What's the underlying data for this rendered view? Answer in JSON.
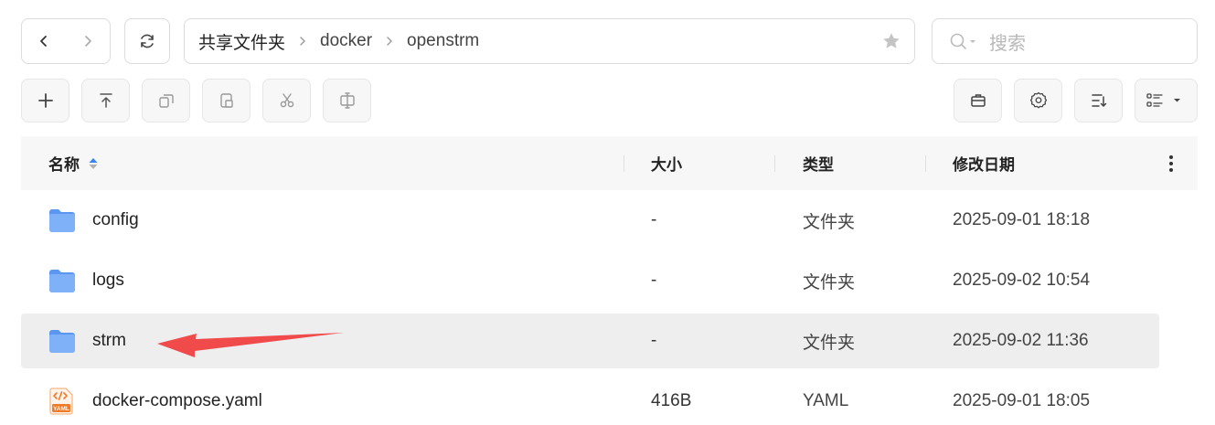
{
  "toolbar": {
    "back_icon": "chevron-left-icon",
    "forward_icon": "chevron-right-icon",
    "refresh_icon": "refresh-icon",
    "actions": [
      {
        "icon": "plus-icon"
      },
      {
        "icon": "upload-icon"
      },
      {
        "icon": "copy-icon"
      },
      {
        "icon": "paste-icon"
      },
      {
        "icon": "cut-icon"
      },
      {
        "icon": "rename-icon"
      }
    ],
    "right_actions": [
      {
        "icon": "briefcase-icon"
      },
      {
        "icon": "gear-icon"
      },
      {
        "icon": "sort-icon"
      },
      {
        "icon": "list-view-icon"
      }
    ]
  },
  "breadcrumb": [
    "共享文件夹",
    "docker",
    "openstrm"
  ],
  "search": {
    "placeholder": "搜索"
  },
  "table": {
    "columns": {
      "name": "名称",
      "size": "大小",
      "type": "类型",
      "modified": "修改日期"
    },
    "rows": [
      {
        "name": "config",
        "size": "-",
        "type": "文件夹",
        "modified": "2025-09-01 18:18",
        "icon": "folder-icon",
        "selected": false
      },
      {
        "name": "logs",
        "size": "-",
        "type": "文件夹",
        "modified": "2025-09-02 10:54",
        "icon": "folder-icon",
        "selected": false
      },
      {
        "name": "strm",
        "size": "-",
        "type": "文件夹",
        "modified": "2025-09-02 11:36",
        "icon": "folder-icon",
        "selected": true
      },
      {
        "name": "docker-compose.yaml",
        "size": "416B",
        "type": "YAML",
        "modified": "2025-09-01 18:05",
        "icon": "yaml-file-icon",
        "selected": false
      }
    ]
  },
  "yaml_badge": "YAML",
  "colors": {
    "folder": "#6da5f7",
    "accent": "#3b82f6",
    "annotation_arrow": "#f04a4a",
    "yaml_icon": "#f07a26"
  }
}
